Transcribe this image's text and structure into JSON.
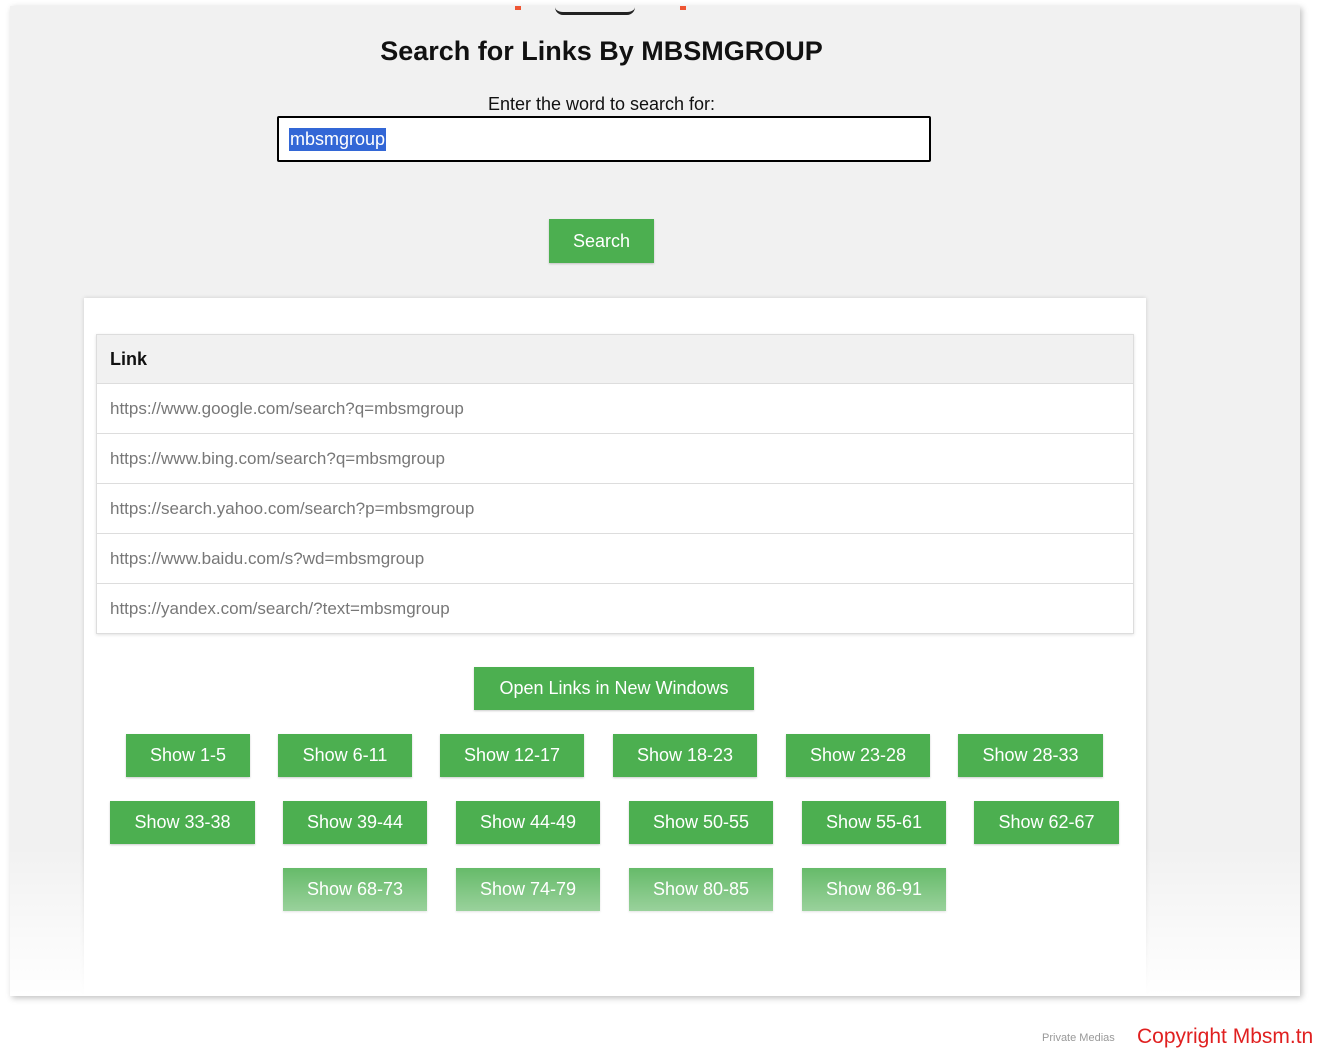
{
  "page": {
    "title": "Search for Links By MBSMGROUP",
    "search_label": "Enter the word to search for:",
    "search_value": "mbsmgroup",
    "search_button": "Search"
  },
  "table": {
    "header": "Link",
    "rows": [
      "https://www.google.com/search?q=mbsmgroup",
      "https://www.bing.com/search?q=mbsmgroup",
      "https://search.yahoo.com/search?p=mbsmgroup",
      "https://www.baidu.com/s?wd=mbsmgroup",
      "https://yandex.com/search/?text=mbsmgroup"
    ]
  },
  "actions": {
    "open_links": "Open Links in New Windows"
  },
  "range_buttons": [
    "Show 1-5",
    "Show 6-11",
    "Show 12-17",
    "Show 18-23",
    "Show 23-28",
    "Show 28-33",
    "Show 33-38",
    "Show 39-44",
    "Show 44-49",
    "Show 50-55",
    "Show 55-61",
    "Show 62-67",
    "Show 68-73",
    "Show 74-79",
    "Show 80-85",
    "Show 86-91"
  ],
  "footer": {
    "small": "Private Medias",
    "copyright": "Copyright Mbsm.tn"
  },
  "colors": {
    "button_green": "#4caf50",
    "selection_blue": "#3367d6",
    "copyright_red": "#e02020"
  }
}
